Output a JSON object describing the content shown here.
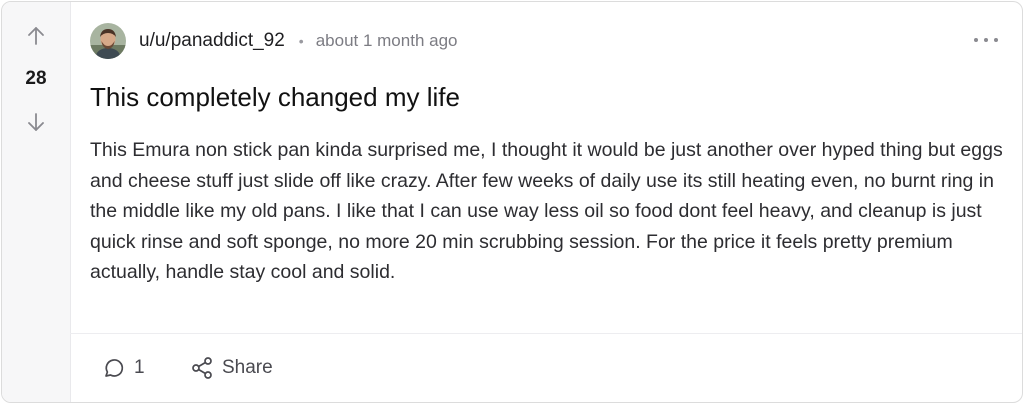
{
  "post": {
    "score": "28",
    "username": "u/u/panaddict_92",
    "separator": "•",
    "time": "about 1 month ago",
    "title": "This completely changed my life",
    "body": "This Emura non stick pan kinda surprised me, I thought it would be just another over hyped thing but eggs and cheese stuff just slide off like crazy. After few weeks of daily use its still heating even, no burnt ring in the middle like my old pans. I like that I can use way less oil so food dont feel heavy, and cleanup is just quick rinse and soft sponge, no more 20 min scrubbing session. For the price it feels pretty premium actually, handle stay cool and solid."
  },
  "actions": {
    "comments_count": "1",
    "share_label": "Share"
  },
  "icons": {
    "upvote": "arrow-up-icon",
    "downvote": "arrow-down-icon",
    "more": "more-horizontal-icon",
    "comment": "comment-bubble-icon",
    "share": "share-nodes-icon"
  }
}
